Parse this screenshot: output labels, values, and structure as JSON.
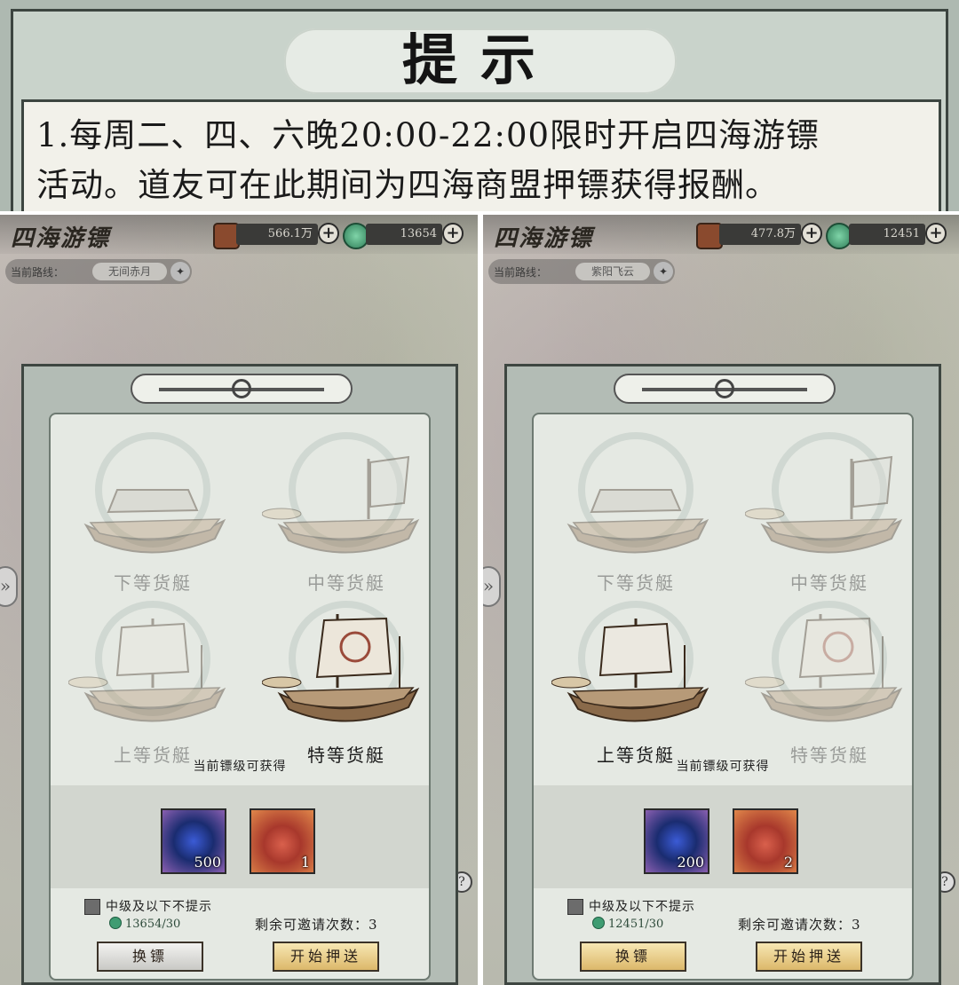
{
  "hint": {
    "title": "提示",
    "line1": "1.每周二、四、六晚20:00-22:00限时开启四海游镖",
    "line2": "活动。道友可在此期间为四海商盟押镖获得报酬。"
  },
  "panes": [
    {
      "game_title": "四海游镖",
      "currency1": "566.1万",
      "currency2": "13654",
      "route_label": "当前路线：",
      "route_value": "无间赤月",
      "ships": [
        "下等货艇",
        "中等货艇",
        "上等货艇",
        "特等货艇"
      ],
      "selected_ship": "特等货艇",
      "reward_caption": "当前镖级可获得",
      "reward1_count": "500",
      "reward2_count": "1",
      "checkbox_label": "中级及以下不提示",
      "coin_cost": "13654/30",
      "remaining": "剩余可邀请次数：3",
      "swap_label": "换镖",
      "start_label": "开始押送"
    },
    {
      "game_title": "四海游镖",
      "currency1": "477.8万",
      "currency2": "12451",
      "route_label": "当前路线：",
      "route_value": "紫阳飞云",
      "ships": [
        "下等货艇",
        "中等货艇",
        "上等货艇",
        "特等货艇"
      ],
      "selected_ship": "上等货艇",
      "reward_caption": "当前镖级可获得",
      "reward1_count": "200",
      "reward2_count": "2",
      "checkbox_label": "中级及以下不提示",
      "coin_cost": "12451/30",
      "remaining": "剩余可邀请次数：3",
      "swap_label": "换镖",
      "start_label": "开始押送"
    }
  ],
  "colors": {
    "gem": "#3b5bd6",
    "bag": "#c04a3a",
    "coin": "#3f9c72",
    "gold_button": "#dcb86a"
  }
}
